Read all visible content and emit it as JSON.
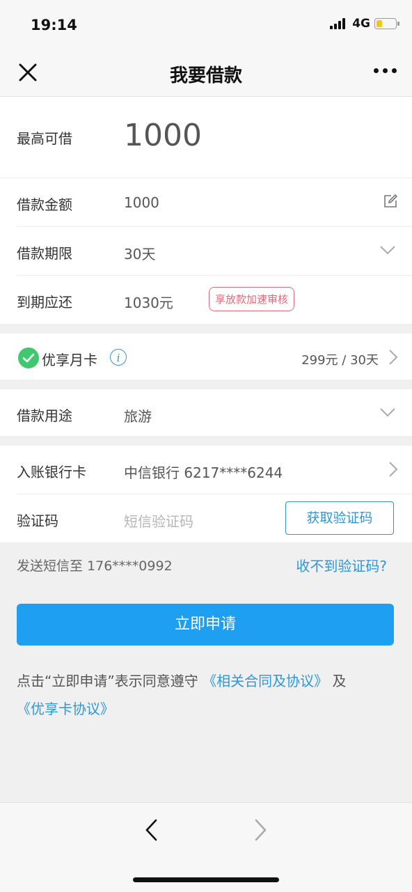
{
  "status_bar": {
    "time": "19:14",
    "network": "4G",
    "battery_level": 0.3,
    "battery_color": "#f5c518"
  },
  "nav": {
    "title": "我要借款"
  },
  "max_loan": {
    "label": "最高可借",
    "value": "1000"
  },
  "loan_form": {
    "amount_label": "借款金额",
    "amount_value": "1000",
    "term_label": "借款期限",
    "term_value": "30天",
    "repay_label": "到期应还",
    "repay_value": "1030元",
    "badge": "享放款加速审核"
  },
  "card": {
    "label": "优享月卡",
    "info_glyph": "i",
    "price": "299元 / 30天",
    "check_color": "#3fc86e"
  },
  "purpose": {
    "label": "借款用途",
    "value": "旅游"
  },
  "bank": {
    "account_label": "入账银行卡",
    "account_value": "中信银行 6217****6244",
    "code_label": "验证码",
    "code_placeholder": "短信验证码",
    "get_code_label": "获取验证码"
  },
  "sms": {
    "sent_to": "发送短信至 176****0992",
    "help": "收不到验证码?"
  },
  "submit": {
    "label": "立即申请",
    "color": "#1e9ff2"
  },
  "agreement": {
    "prefix": "点击“立即申请”表示同意遵守",
    "link1": "《相关合同及协议》",
    "and": "及",
    "link2": "《优享卡协议》"
  },
  "colors": {
    "accent": "#2f96d8",
    "badge": "#e46a7a"
  }
}
